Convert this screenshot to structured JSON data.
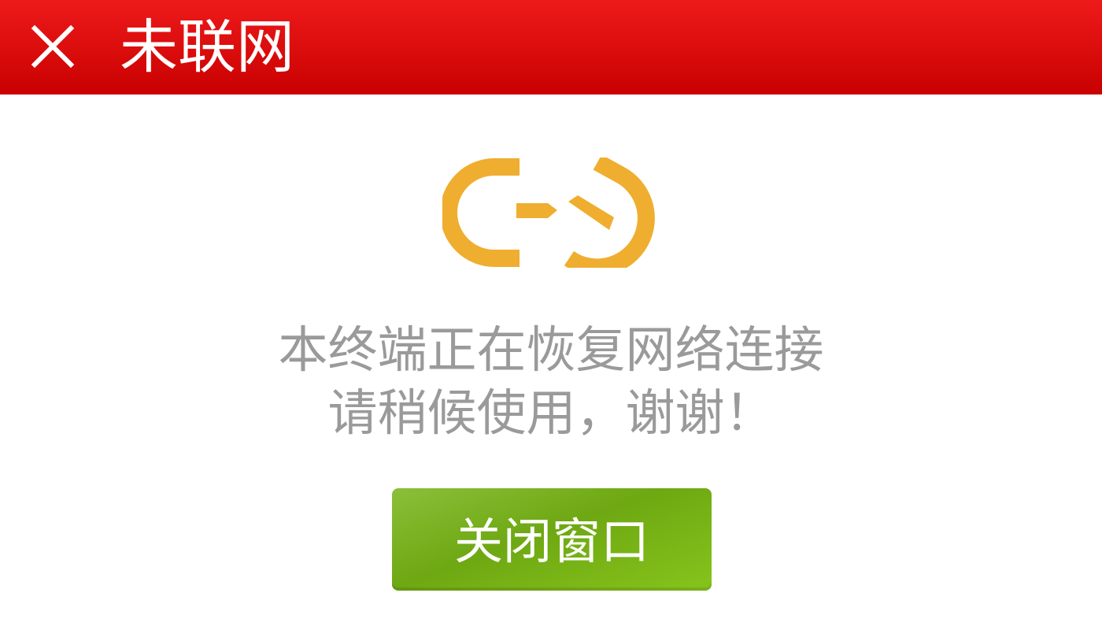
{
  "header": {
    "title": "未联网",
    "close_icon": "close-icon",
    "background_color": "#e01010"
  },
  "main": {
    "icon": "broken-link-icon",
    "icon_color": "#efae2f",
    "message_line1": "本终端正在恢复网络连接",
    "message_line2": "请稍候使用，谢谢！",
    "close_button_label": "关闭窗口",
    "button_color": "#7ab41e"
  }
}
